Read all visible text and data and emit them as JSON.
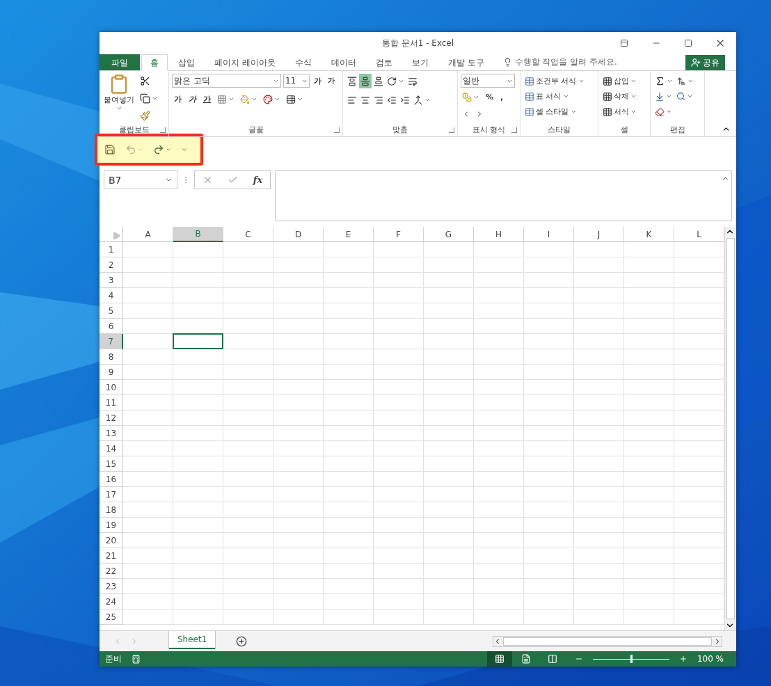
{
  "window": {
    "title": "통합 문서1 - Excel"
  },
  "tabs": [
    {
      "label": "파일",
      "kind": "file",
      "selected": false
    },
    {
      "label": "홈",
      "kind": "tab",
      "selected": true
    },
    {
      "label": "삽입",
      "kind": "tab",
      "selected": false
    },
    {
      "label": "페이지 레이아웃",
      "kind": "tab",
      "selected": false
    },
    {
      "label": "수식",
      "kind": "tab",
      "selected": false
    },
    {
      "label": "데이터",
      "kind": "tab",
      "selected": false
    },
    {
      "label": "검토",
      "kind": "tab",
      "selected": false
    },
    {
      "label": "보기",
      "kind": "tab",
      "selected": false
    },
    {
      "label": "개발 도구",
      "kind": "tab",
      "selected": false
    }
  ],
  "tell_me": {
    "placeholder": "수행할 작업을 알려 주세요."
  },
  "share": {
    "label": "공유"
  },
  "ribbon": {
    "clipboard": {
      "paste": "붙여넣기",
      "label": "클립보드"
    },
    "font": {
      "name": "맑은 고딕",
      "size": "11",
      "grow": "가",
      "shrink": "가",
      "bold": "가",
      "italic": "가",
      "underline": "가",
      "label": "글꼴"
    },
    "alignment": {
      "vertical": [
        {
          "selected": false
        },
        {
          "selected": true
        },
        {
          "selected": false
        }
      ],
      "label": "맞춤"
    },
    "number": {
      "format": "일반",
      "percent": "%",
      "comma": ",",
      "label": "표시 형식"
    },
    "styles": {
      "items": [
        "조건부 서식",
        "표 서식",
        "셀 스타일"
      ],
      "label": "스타일"
    },
    "cells": {
      "items": [
        "삽입",
        "삭제",
        "서식"
      ],
      "label": "셀"
    },
    "editing": {
      "label": "편집"
    }
  },
  "quick_access": {
    "undo_disabled": true,
    "highlighted": true
  },
  "formula_bar": {
    "name_box": "B7",
    "fx": "fx"
  },
  "sheet": {
    "columns": [
      {
        "label": "A",
        "selected": false
      },
      {
        "label": "B",
        "selected": true
      },
      {
        "label": "C",
        "selected": false
      },
      {
        "label": "D",
        "selected": false
      },
      {
        "label": "E",
        "selected": false
      },
      {
        "label": "F",
        "selected": false
      },
      {
        "label": "G",
        "selected": false
      },
      {
        "label": "H",
        "selected": false
      },
      {
        "label": "I",
        "selected": false
      },
      {
        "label": "J",
        "selected": false
      },
      {
        "label": "K",
        "selected": false
      },
      {
        "label": "L",
        "selected": false
      }
    ],
    "rows": [
      {
        "label": "1",
        "selected": false
      },
      {
        "label": "2",
        "selected": false
      },
      {
        "label": "3",
        "selected": false
      },
      {
        "label": "4",
        "selected": false
      },
      {
        "label": "5",
        "selected": false
      },
      {
        "label": "6",
        "selected": false
      },
      {
        "label": "7",
        "selected": true
      },
      {
        "label": "8",
        "selected": false
      },
      {
        "label": "9",
        "selected": false
      },
      {
        "label": "10",
        "selected": false
      },
      {
        "label": "11",
        "selected": false
      },
      {
        "label": "12",
        "selected": false
      },
      {
        "label": "13",
        "selected": false
      },
      {
        "label": "14",
        "selected": false
      },
      {
        "label": "15",
        "selected": false
      },
      {
        "label": "16",
        "selected": false
      },
      {
        "label": "17",
        "selected": false
      },
      {
        "label": "18",
        "selected": false
      },
      {
        "label": "19",
        "selected": false
      },
      {
        "label": "20",
        "selected": false
      },
      {
        "label": "21",
        "selected": false
      },
      {
        "label": "22",
        "selected": false
      },
      {
        "label": "23",
        "selected": false
      },
      {
        "label": "24",
        "selected": false
      },
      {
        "label": "25",
        "selected": false
      }
    ]
  },
  "sheet_tabs": [
    {
      "label": "Sheet1",
      "selected": true
    }
  ],
  "status_bar": {
    "status": "준비",
    "views": [
      {
        "kind": "normal",
        "selected": true
      },
      {
        "kind": "page_layout",
        "selected": false
      },
      {
        "kind": "page_break",
        "selected": false
      }
    ],
    "zoom": {
      "level": 0.5
    },
    "zoom_text": "100 %"
  }
}
